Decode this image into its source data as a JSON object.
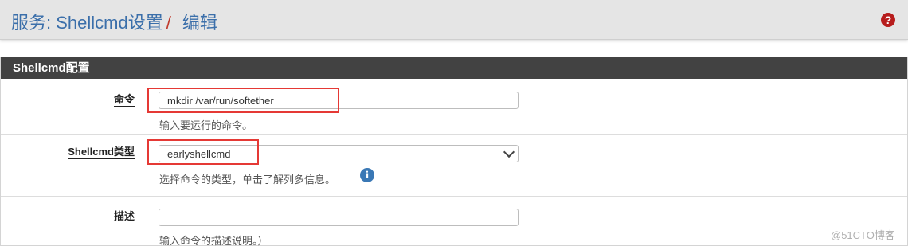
{
  "header": {
    "breadcrumb_service": "服务: Shellcmd设置",
    "breadcrumb_separator": "/",
    "breadcrumb_current": "编辑",
    "help_icon": "question-circle-icon"
  },
  "panel": {
    "title": "Shellcmd配置"
  },
  "fields": {
    "command": {
      "label": "命令",
      "value": "mkdir /var/run/softether",
      "help": "输入要运行的命令。"
    },
    "type": {
      "label": "Shellcmd类型",
      "value": "earlyshellcmd",
      "help": "选择命令的类型，单击了解列多信息。",
      "info_icon": "info-circle-icon"
    },
    "description": {
      "label": "描述",
      "value": "",
      "help": "输入命令的描述说明。）"
    }
  },
  "watermark": "@51CTO博客",
  "colors": {
    "header_bg": "#e5e5e5",
    "breadcrumb_text": "#3b6faa",
    "panel_heading_bg": "#424242",
    "highlight": "#e53935",
    "help_icon": "#b71c1c",
    "info_icon": "#3a78b5"
  }
}
